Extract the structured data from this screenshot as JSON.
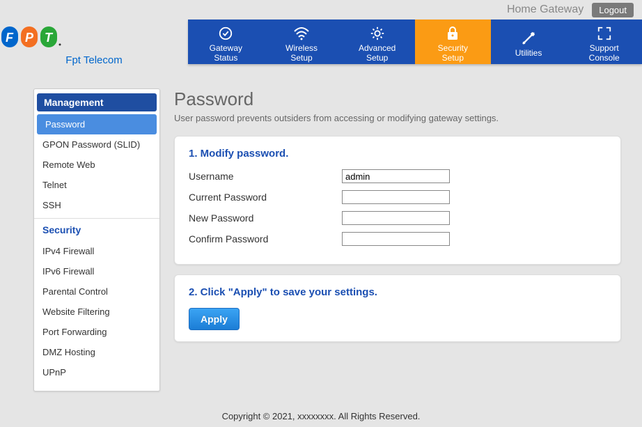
{
  "topbar": {
    "title": "Home Gateway",
    "logout": "Logout"
  },
  "logo": {
    "subtext": "Fpt Telecom"
  },
  "nav": {
    "items": [
      {
        "label": "Gateway\nStatus"
      },
      {
        "label": "Wireless\nSetup"
      },
      {
        "label": "Advanced\nSetup"
      },
      {
        "label": "Security\nSetup"
      },
      {
        "label": "Utilities"
      },
      {
        "label": "Support\nConsole"
      }
    ]
  },
  "sidebar": {
    "management": {
      "header": "Management",
      "items": [
        {
          "label": "Password"
        },
        {
          "label": "GPON Password (SLID)"
        },
        {
          "label": "Remote Web"
        },
        {
          "label": "Telnet"
        },
        {
          "label": "SSH"
        }
      ]
    },
    "security": {
      "header": "Security",
      "items": [
        {
          "label": "IPv4 Firewall"
        },
        {
          "label": "IPv6 Firewall"
        },
        {
          "label": "Parental Control"
        },
        {
          "label": "Website Filtering"
        },
        {
          "label": "Port Forwarding"
        },
        {
          "label": "DMZ Hosting"
        },
        {
          "label": "UPnP"
        }
      ]
    }
  },
  "page": {
    "title": "Password",
    "description": "User password prevents outsiders from accessing or modifying gateway settings."
  },
  "panel1": {
    "heading": "1. Modify password.",
    "username_label": "Username",
    "username_value": "admin",
    "current_label": "Current Password",
    "new_label": "New Password",
    "confirm_label": "Confirm Password"
  },
  "panel2": {
    "heading": "2. Click \"Apply\" to save your settings.",
    "apply": "Apply"
  },
  "footer": "Copyright © 2021, xxxxxxxx. All Rights Reserved."
}
